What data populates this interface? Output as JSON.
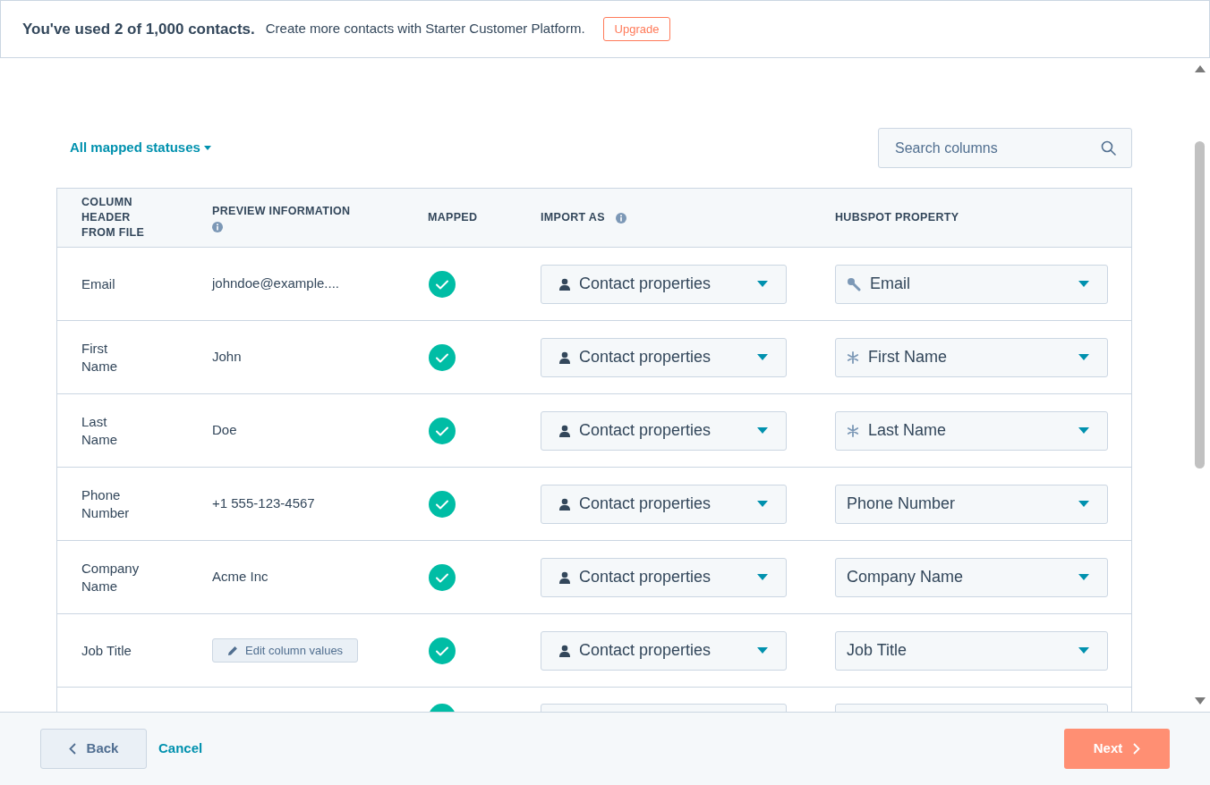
{
  "banner": {
    "headline": "You've used 2 of 1,000 contacts.",
    "message": "Create more contacts with Starter Customer Platform.",
    "button": "Upgrade"
  },
  "filter": {
    "label": "All mapped statuses"
  },
  "search": {
    "placeholder": "Search columns"
  },
  "table": {
    "columns": [
      "COLUMN HEADER FROM FILE",
      "PREVIEW INFORMATION",
      "MAPPED",
      "IMPORT AS",
      "HUBSPOT PROPERTY"
    ],
    "rows": [
      {
        "header": "Email",
        "preview": {
          "kind": "text",
          "label": "johndoe@example...."
        },
        "mapped": true,
        "import_as": "Contact properties",
        "property": {
          "kind": "key",
          "label": "Email"
        }
      },
      {
        "header": "First Name",
        "preview": {
          "kind": "text",
          "label": "John"
        },
        "mapped": true,
        "import_as": "Contact properties",
        "property": {
          "kind": "required",
          "label": "First Name"
        }
      },
      {
        "header": "Last Name",
        "preview": {
          "kind": "text",
          "label": "Doe"
        },
        "mapped": true,
        "import_as": "Contact properties",
        "property": {
          "kind": "required",
          "label": "Last Name"
        }
      },
      {
        "header": "Phone Number",
        "preview": {
          "kind": "text",
          "label": "+1 555-123-4567"
        },
        "mapped": true,
        "import_as": "Contact properties",
        "property": {
          "kind": "plain",
          "label": "Phone Number"
        }
      },
      {
        "header": "Company Name",
        "preview": {
          "kind": "text",
          "label": "Acme Inc"
        },
        "mapped": true,
        "import_as": "Contact properties",
        "property": {
          "kind": "plain",
          "label": "Company Name"
        }
      },
      {
        "header": "Job Title",
        "preview": {
          "kind": "button",
          "label": "Edit column values"
        },
        "mapped": true,
        "import_as": "Contact properties",
        "property": {
          "kind": "plain",
          "label": "Job Title"
        }
      }
    ]
  },
  "footer": {
    "back": "Back",
    "cancel": "Cancel",
    "next": "Next"
  }
}
